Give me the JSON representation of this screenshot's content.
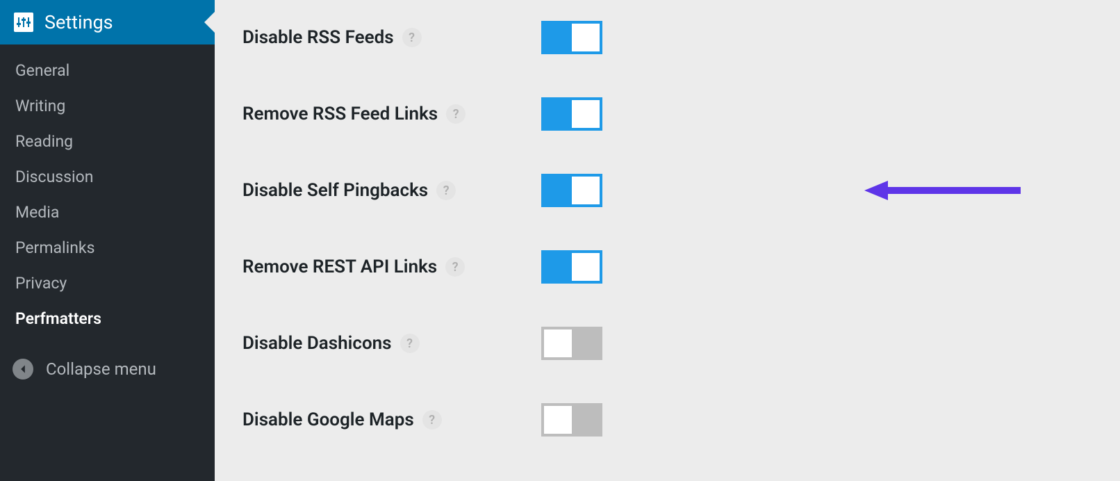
{
  "sidebar": {
    "settings_label": "Settings",
    "items": [
      {
        "label": "General",
        "active": false
      },
      {
        "label": "Writing",
        "active": false
      },
      {
        "label": "Reading",
        "active": false
      },
      {
        "label": "Discussion",
        "active": false
      },
      {
        "label": "Media",
        "active": false
      },
      {
        "label": "Permalinks",
        "active": false
      },
      {
        "label": "Privacy",
        "active": false
      },
      {
        "label": "Perfmatters",
        "active": true
      }
    ],
    "collapse_label": "Collapse menu"
  },
  "settings": [
    {
      "label": "Disable RSS Feeds",
      "enabled": true,
      "highlighted": false
    },
    {
      "label": "Remove RSS Feed Links",
      "enabled": true,
      "highlighted": false
    },
    {
      "label": "Disable Self Pingbacks",
      "enabled": true,
      "highlighted": true
    },
    {
      "label": "Remove REST API Links",
      "enabled": true,
      "highlighted": false
    },
    {
      "label": "Disable Dashicons",
      "enabled": false,
      "highlighted": false
    },
    {
      "label": "Disable Google Maps",
      "enabled": false,
      "highlighted": false
    }
  ],
  "colors": {
    "sidebar_bg": "#23282d",
    "accent": "#0073aa",
    "toggle_on": "#1e9ae8",
    "toggle_off": "#bdbdbd",
    "arrow": "#5e35e8"
  }
}
